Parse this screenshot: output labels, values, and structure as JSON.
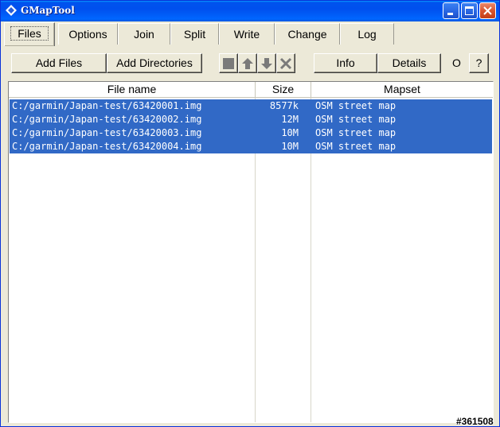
{
  "window": {
    "title": "GMapTool"
  },
  "tabs": [
    {
      "label": "Files",
      "active": true
    },
    {
      "label": "Options",
      "active": false
    },
    {
      "label": "Join",
      "active": false
    },
    {
      "label": "Split",
      "active": false
    },
    {
      "label": "Write",
      "active": false
    },
    {
      "label": "Change",
      "active": false
    },
    {
      "label": "Log",
      "active": false
    }
  ],
  "toolbar": {
    "add_files": "Add Files",
    "add_directories": "Add Directories",
    "stop_icon": "stop-square-icon",
    "up_icon": "arrow-up-icon",
    "down_icon": "arrow-down-icon",
    "remove_icon": "x-remove-icon",
    "info": "Info",
    "details": "Details",
    "o_label": "O",
    "help": "?"
  },
  "table": {
    "columns": [
      "File name",
      "Size",
      "Mapset"
    ],
    "rows": [
      {
        "name": "C:/garmin/Japan-test/63420001.img",
        "size": "8577k",
        "mapset": "OSM street map",
        "selected": true
      },
      {
        "name": "C:/garmin/Japan-test/63420002.img",
        "size": "12M",
        "mapset": "OSM street map",
        "selected": true
      },
      {
        "name": "C:/garmin/Japan-test/63420003.img",
        "size": "10M",
        "mapset": "OSM street map",
        "selected": true
      },
      {
        "name": "C:/garmin/Japan-test/63420004.img",
        "size": "10M",
        "mapset": "OSM street map",
        "selected": true
      }
    ]
  },
  "watermark": "#361508",
  "colors": {
    "selection": "#3169c6",
    "titlebar": "#0053ee",
    "face": "#ece9d8"
  }
}
